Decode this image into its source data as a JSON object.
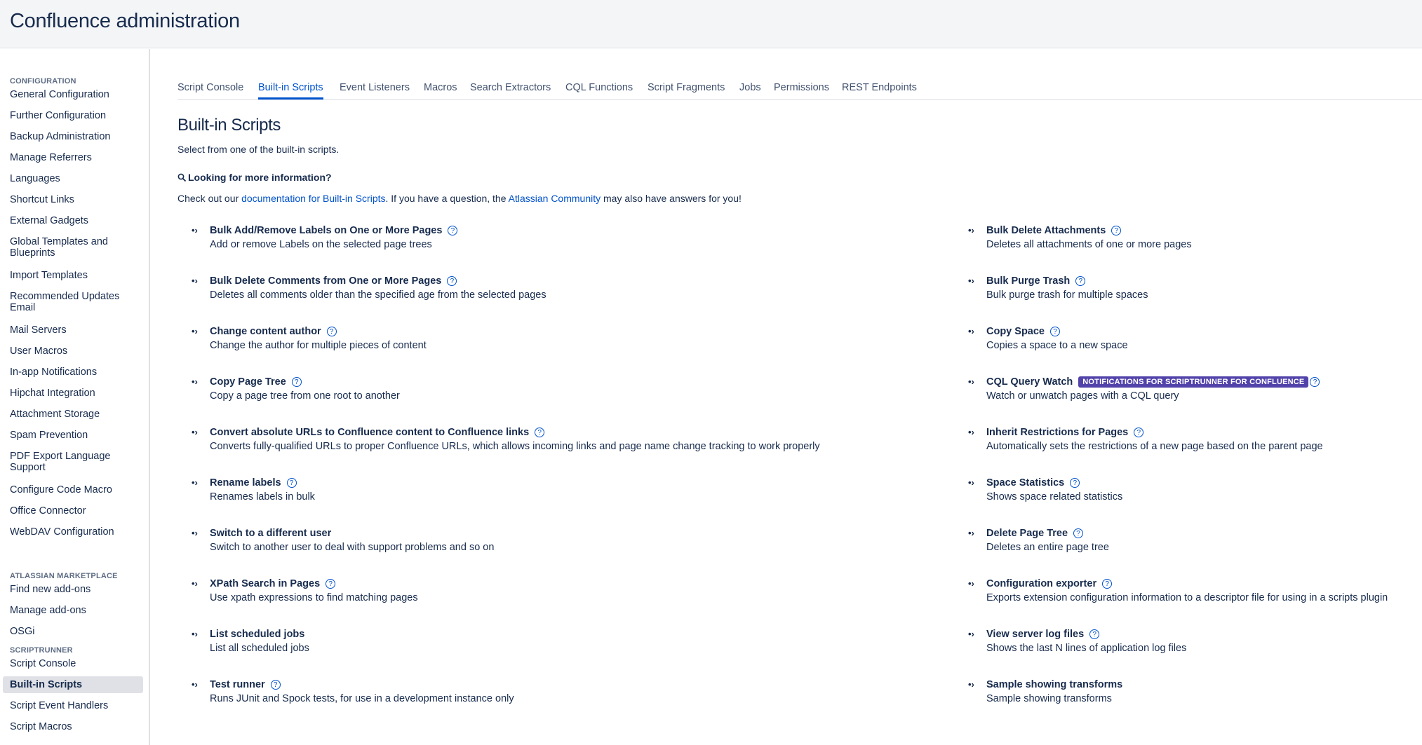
{
  "header": {
    "title": "Confluence administration"
  },
  "sidebar": {
    "sections": [
      {
        "title": "CONFIGURATION",
        "items": [
          "General Configuration",
          "Further Configuration",
          "Backup Administration",
          "Manage Referrers",
          "Languages",
          "Shortcut Links",
          "External Gadgets",
          "Global Templates and Blueprints",
          "Import Templates",
          "Recommended Updates Email",
          "Mail Servers",
          "User Macros",
          "In-app Notifications",
          "Hipchat Integration",
          "Attachment Storage",
          "Spam Prevention",
          "PDF Export Language Support",
          "Configure Code Macro",
          "Office Connector",
          "WebDAV Configuration"
        ]
      },
      {
        "title": "ATLASSIAN MARKETPLACE",
        "items": [
          "Find new add-ons",
          "Manage add-ons",
          "OSGi"
        ]
      },
      {
        "title": "SCRIPTRUNNER",
        "items": [
          "Script Console",
          "Built-in Scripts",
          "Script Event Handlers",
          "Script Macros"
        ]
      }
    ],
    "active_item": "Built-in Scripts"
  },
  "tabs": [
    {
      "label": "Script Console",
      "active": false
    },
    {
      "label": "Built-in Scripts",
      "active": true
    },
    {
      "label": "Event Listeners",
      "active": false
    },
    {
      "label": "Macros",
      "active": false
    },
    {
      "label": "Search Extractors",
      "active": false
    },
    {
      "label": "CQL Functions",
      "active": false
    },
    {
      "label": "Script Fragments",
      "active": false
    },
    {
      "label": "Jobs",
      "active": false
    },
    {
      "label": "Permissions",
      "active": false
    },
    {
      "label": "REST Endpoints",
      "active": false
    }
  ],
  "main": {
    "title": "Built-in Scripts",
    "subtitle": "Select from one of the built-in scripts.",
    "info_heading": "Looking for more information?",
    "info_text_1": "Check out our ",
    "info_link_1": "documentation for Built-in Scripts",
    "info_text_2": ". If you have a question, the ",
    "info_link_2": "Atlassian Community",
    "info_text_3": " may also have answers for you!",
    "bullet_glyph": "•›",
    "help_glyph": "?"
  },
  "scripts_left": [
    {
      "title": "Bulk Add/Remove Labels on One or More Pages",
      "desc": "Add or remove Labels on the selected page trees",
      "help": true
    },
    {
      "title": "Bulk Delete Comments from One or More Pages",
      "desc": "Deletes all comments older than the specified age from the selected pages",
      "help": true
    },
    {
      "title": "Change content author",
      "desc": "Change the author for multiple pieces of content",
      "help": true
    },
    {
      "title": "Copy Page Tree",
      "desc": "Copy a page tree from one root to another",
      "help": true
    },
    {
      "title": "Convert absolute URLs to Confluence content to Confluence links",
      "desc": "Converts fully-qualified URLs to proper Confluence URLs, which allows incoming links and page name change tracking to work properly",
      "help": true
    },
    {
      "title": "Rename labels",
      "desc": "Renames labels in bulk",
      "help": true
    },
    {
      "title": "Switch to a different user",
      "desc": "Switch to another user to deal with support problems and so on",
      "help": false
    },
    {
      "title": "XPath Search in Pages",
      "desc": "Use xpath expressions to find matching pages",
      "help": true
    },
    {
      "title": "List scheduled jobs",
      "desc": "List all scheduled jobs",
      "help": false
    },
    {
      "title": "Test runner",
      "desc": "Runs JUnit and Spock tests, for use in a development instance only",
      "help": true
    }
  ],
  "scripts_right": [
    {
      "title": "Bulk Delete Attachments",
      "desc": "Deletes all attachments of one or more pages",
      "help": true
    },
    {
      "title": "Bulk Purge Trash",
      "desc": "Bulk purge trash for multiple spaces",
      "help": true
    },
    {
      "title": "Copy Space",
      "desc": "Copies a space to a new space",
      "help": true
    },
    {
      "title": "CQL Query Watch",
      "desc": "Watch or unwatch pages with a CQL query",
      "help": true,
      "badge": "NOTIFICATIONS FOR SCRIPTRUNNER FOR CONFLUENCE"
    },
    {
      "title": "Inherit Restrictions for Pages",
      "desc": "Automatically sets the restrictions of a new page based on the parent page",
      "help": true
    },
    {
      "title": "Space Statistics",
      "desc": "Shows space related statistics",
      "help": true
    },
    {
      "title": "Delete Page Tree",
      "desc": "Deletes an entire page tree",
      "help": true
    },
    {
      "title": "Configuration exporter",
      "desc": "Exports extension configuration information to a descriptor file for using in a scripts plugin",
      "help": true
    },
    {
      "title": "View server log files",
      "desc": "Shows the last N lines of application log files",
      "help": true
    },
    {
      "title": "Sample showing transforms",
      "desc": "Sample showing transforms",
      "help": false
    }
  ],
  "colors": {
    "link": "#0052cc",
    "badge": "#5243aa",
    "text": "#172b4d"
  }
}
